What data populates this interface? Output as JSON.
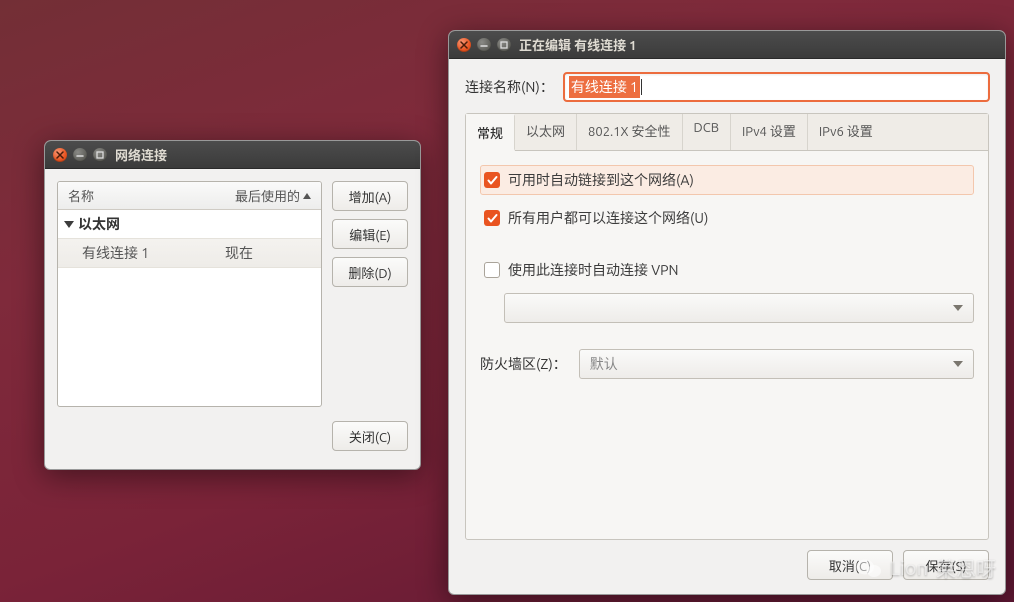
{
  "nc": {
    "title": "网络连接",
    "col_name": "名称",
    "col_last_used": "最后使用的",
    "group": "以太网",
    "item_name": "有线连接 1",
    "item_last_used": "现在",
    "btn_add": "增加(A)",
    "btn_edit": "编辑(E)",
    "btn_delete": "删除(D)",
    "btn_close": "关闭(C)"
  },
  "ed": {
    "title": "正在编辑 有线连接 1",
    "name_label": "连接名称(N)：",
    "name_value": "有线连接 1",
    "tabs": {
      "general": "常规",
      "ethernet": "以太网",
      "security": "802.1X 安全性",
      "dcb": "DCB",
      "ipv4": "IPv4 设置",
      "ipv6": "IPv6 设置"
    },
    "chk_auto_connect": "可用时自动链接到这个网络(A)",
    "chk_all_users": "所有用户都可以连接这个网络(U)",
    "chk_vpn": "使用此连接时自动连接 VPN",
    "vpn_combo": "",
    "firewall_label": "防火墙区(Z)：",
    "firewall_value": "默认",
    "btn_cancel": "取消(C)",
    "btn_save": "保存(S)"
  },
  "watermark": {
    "text1": "Lion",
    "text2": "莱恩呀"
  }
}
